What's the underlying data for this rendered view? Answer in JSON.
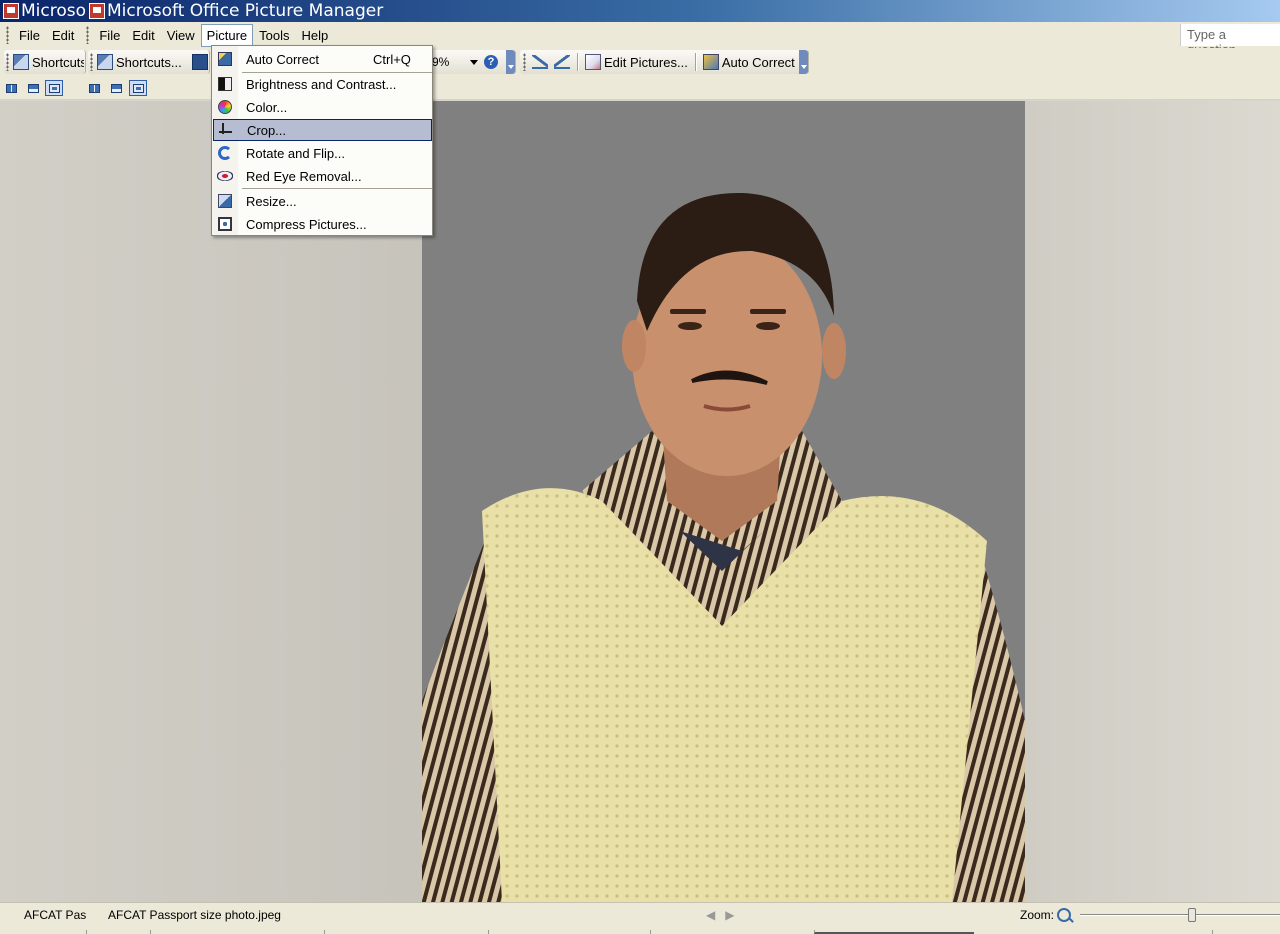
{
  "window": {
    "title_a": "Microso",
    "title_b": "Microsoft Office Picture Manager"
  },
  "menubar": {
    "items_a": [
      "File",
      "Edit"
    ],
    "items_b": [
      "File",
      "Edit",
      "View",
      "Picture",
      "Tools",
      "Help"
    ],
    "active": "Picture",
    "help_placeholder": "Type a question"
  },
  "toolbar": {
    "shortcuts_a": "Shortcuts",
    "shortcuts_b": "Shortcuts...",
    "zoom_value": "9%",
    "edit_pictures": "Edit Pictures...",
    "auto_correct": "Auto Correct"
  },
  "picture_menu": {
    "items": [
      {
        "label": "Auto Correct",
        "shortcut": "Ctrl+Q",
        "icon": "auto-correct-icon"
      },
      {
        "label": "Brightness and Contrast...",
        "icon": "brightness-icon"
      },
      {
        "label": "Color...",
        "icon": "color-icon"
      },
      {
        "label": "Crop...",
        "icon": "crop-icon",
        "highlighted": true
      },
      {
        "label": "Rotate and Flip...",
        "icon": "rotate-icon"
      },
      {
        "label": "Red Eye Removal...",
        "icon": "red-eye-icon"
      },
      {
        "label": "Resize...",
        "icon": "resize-icon"
      },
      {
        "label": "Compress Pictures...",
        "icon": "compress-icon"
      }
    ]
  },
  "statusbar": {
    "thumb_label": "AFCAT Passport size photo.jpeg",
    "file_name": "AFCAT Passport size photo.jpeg",
    "zoom_label": "Zoom:",
    "zoom_level": 0.56
  },
  "colors": {
    "title_start": "#0a246a",
    "menu_bg": "#ece9d8",
    "highlight": "#b6bdd2",
    "photo_bg": "#808080"
  }
}
